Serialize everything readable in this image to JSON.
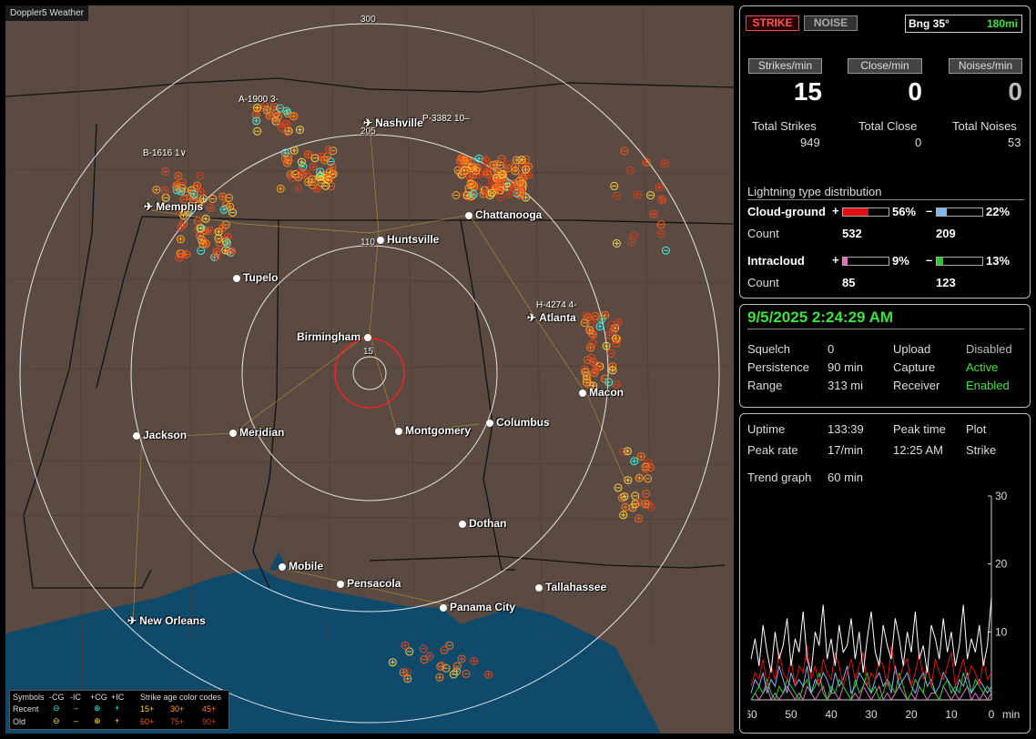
{
  "map": {
    "title": "Doppler5 Weather",
    "rings": [
      "300",
      "205",
      "110",
      "15"
    ],
    "cities": [
      {
        "name": "Nashville",
        "airport": true
      },
      {
        "name": "Memphis",
        "airport": true
      },
      {
        "name": "Chattanooga",
        "airport": false
      },
      {
        "name": "Huntsville",
        "airport": false
      },
      {
        "name": "Tupelo",
        "airport": false
      },
      {
        "name": "Atlanta",
        "airport": true
      },
      {
        "name": "Birmingham",
        "airport": false
      },
      {
        "name": "Macon",
        "airport": false
      },
      {
        "name": "Jackson",
        "airport": false
      },
      {
        "name": "Meridian",
        "airport": false
      },
      {
        "name": "Montgomery",
        "airport": false
      },
      {
        "name": "Columbus",
        "airport": false
      },
      {
        "name": "Dothan",
        "airport": false
      },
      {
        "name": "Mobile",
        "airport": false
      },
      {
        "name": "Pensacola",
        "airport": false
      },
      {
        "name": "Tallahassee",
        "airport": false
      },
      {
        "name": "Panama City",
        "airport": false
      },
      {
        "name": "New Orleans",
        "airport": true
      }
    ],
    "annotations": [
      "A-1900  3-",
      "B-1616  1∨",
      "P-3382  10–",
      "H-4274  4-"
    ]
  },
  "legend": {
    "symbols_label": "Symbols",
    "col_headers": [
      "-CG",
      "-IC",
      "+CG",
      "+IC"
    ],
    "age_label": "Strike age color codes",
    "recent_label": "Recent",
    "old_label": "Old",
    "recent_ages": [
      "15+",
      "30+",
      "45+"
    ],
    "old_ages": [
      "60+",
      "75+",
      "90+"
    ],
    "age_colors": [
      "#ffd23c",
      "#ffa028",
      "#ff7a1e",
      "#ff5a14",
      "#e8461e",
      "#d0401a"
    ]
  },
  "status": {
    "strike_label": "STRIKE",
    "noise_label": "NOISE",
    "bearing": "Bng 35°",
    "range": "180mi",
    "rate_headers": [
      "Strikes/min",
      "Close/min",
      "Noises/min"
    ],
    "rate_values": [
      "15",
      "0",
      "0"
    ],
    "total_labels": [
      "Total Strikes",
      "Total Close",
      "Total Noises"
    ],
    "total_values": [
      "949",
      "0",
      "53"
    ]
  },
  "distribution": {
    "title": "Lightning type distribution",
    "cg_label": "Cloud-ground",
    "ic_label": "Intracloud",
    "count_label": "Count",
    "cg_pos": {
      "sign": "+",
      "pct": "56%",
      "count": "532",
      "fraction": 0.56,
      "color": "#e01010"
    },
    "cg_neg": {
      "sign": "–",
      "pct": "22%",
      "count": "209",
      "fraction": 0.22,
      "color": "#7fb8f0"
    },
    "ic_pos": {
      "sign": "+",
      "pct": "9%",
      "count": "85",
      "fraction": 0.09,
      "color": "#e070c0"
    },
    "ic_neg": {
      "sign": "–",
      "pct": "13%",
      "count": "123",
      "fraction": 0.13,
      "color": "#20d020"
    }
  },
  "settings": {
    "datetime": "9/5/2025 2:24:29 AM",
    "squelch_label": "Squelch",
    "squelch": "0",
    "persistence_label": "Persistence",
    "persistence": "90 min",
    "range_label": "Range",
    "range": "313 mi",
    "upload_label": "Upload",
    "upload": "Disabled",
    "capture_label": "Capture",
    "capture": "Active",
    "receiver_label": "Receiver",
    "receiver": "Enabled"
  },
  "stats": {
    "uptime_label": "Uptime",
    "uptime": "133:39",
    "peak_time_label": "Peak time",
    "plot_label": "Plot",
    "peak_rate_label": "Peak rate",
    "peak_rate": "17/min",
    "peak_time": "12:25 AM",
    "plot": "Strike",
    "trend_label": "Trend graph",
    "trend_window": "60 min"
  },
  "chart_data": {
    "type": "line",
    "x_tick_labels": [
      "60",
      "50",
      "40",
      "30",
      "20",
      "10",
      "0"
    ],
    "x_unit": "min",
    "y_tick_labels": [
      "30",
      "20",
      "10"
    ],
    "ylim": [
      0,
      30
    ],
    "xlim": [
      60,
      0
    ],
    "series": [
      {
        "color": "#ffffff",
        "values": [
          6,
          9,
          5,
          11,
          7,
          4,
          10,
          6,
          8,
          12,
          5,
          9,
          7,
          13,
          6,
          4,
          10,
          8,
          14,
          6,
          9,
          5,
          11,
          7,
          8,
          12,
          6,
          10,
          4,
          9,
          13,
          7,
          5,
          11,
          8,
          6,
          12,
          9,
          5,
          10,
          7,
          13,
          6,
          8,
          4,
          11,
          9,
          6,
          12,
          7,
          10,
          5,
          8,
          14,
          6,
          9,
          7,
          11,
          5,
          8,
          15
        ]
      },
      {
        "color": "#e01010",
        "values": [
          2,
          4,
          3,
          6,
          2,
          5,
          3,
          7,
          4,
          3,
          6,
          2,
          5,
          4,
          8,
          3,
          5,
          2,
          6,
          4,
          3,
          7,
          5,
          2,
          4,
          6,
          3,
          5,
          7,
          2,
          4,
          3,
          6,
          5,
          2,
          8,
          4,
          3,
          5,
          6,
          2,
          4,
          7,
          3,
          5,
          2,
          6,
          4,
          3,
          5,
          7,
          2,
          4,
          6,
          3,
          5,
          4,
          2,
          6,
          3,
          4
        ]
      },
      {
        "color": "#7fb8f0",
        "values": [
          1,
          3,
          2,
          4,
          1,
          3,
          2,
          5,
          3,
          1,
          4,
          2,
          3,
          2,
          5,
          1,
          3,
          2,
          4,
          3,
          1,
          4,
          2,
          3,
          5,
          1,
          2,
          4,
          3,
          2,
          1,
          3,
          4,
          2,
          3,
          1,
          5,
          2,
          3,
          4,
          2,
          1,
          3,
          4,
          2,
          3,
          1,
          2,
          4,
          3,
          2,
          1,
          3,
          2,
          4,
          1,
          2,
          3,
          2,
          1,
          2
        ]
      },
      {
        "color": "#20d020",
        "values": [
          0,
          1,
          2,
          1,
          3,
          1,
          0,
          2,
          1,
          3,
          2,
          1,
          0,
          2,
          3,
          1,
          2,
          4,
          1,
          0,
          2,
          1,
          3,
          2,
          1,
          0,
          3,
          1,
          2,
          4,
          1,
          2,
          0,
          1,
          3,
          2,
          1,
          4,
          2,
          0,
          1,
          3,
          2,
          1,
          5,
          2,
          1,
          0,
          2,
          3,
          1,
          2,
          1,
          4,
          2,
          1,
          3,
          2,
          1,
          2,
          1
        ]
      },
      {
        "color": "#e070c0",
        "values": [
          0,
          1,
          0,
          1,
          2,
          0,
          1,
          0,
          1,
          2,
          1,
          0,
          1,
          0,
          2,
          1,
          0,
          1,
          2,
          0,
          1,
          1,
          0,
          2,
          1,
          0,
          1,
          0,
          2,
          1,
          0,
          1,
          2,
          0,
          1,
          0,
          1,
          2,
          1,
          0,
          1,
          0,
          2,
          1,
          0,
          1,
          1,
          0,
          2,
          1,
          0,
          1,
          0,
          1,
          2,
          0,
          1,
          0,
          1,
          0,
          1
        ]
      }
    ]
  }
}
